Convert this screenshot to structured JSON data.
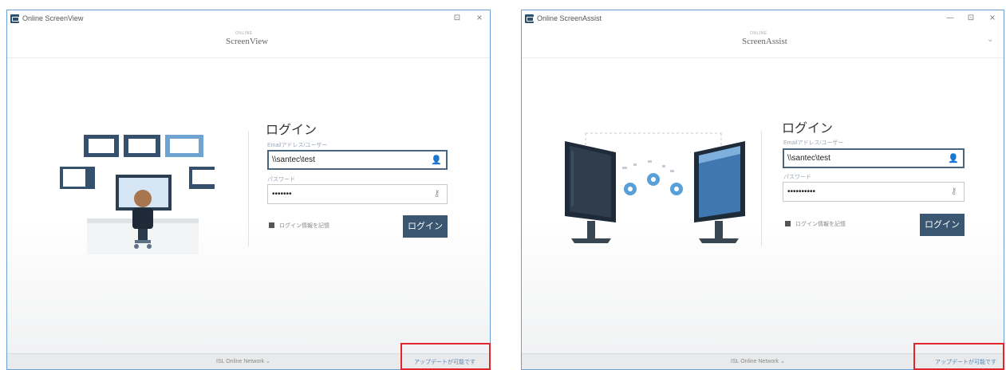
{
  "left_window": {
    "title": "Online ScreenView",
    "window_controls": [
      "⊡",
      "×"
    ],
    "header": {
      "logo_small": "ONLINE",
      "logo": "ScreenView"
    },
    "login": {
      "heading": "ログイン",
      "email_label": "Emailアドレス/ユーザー",
      "email_value": "\\\\santec\\test",
      "password_label": "パスワード",
      "password_value": "•••••••",
      "remember_label": "ログイン情報を記憶",
      "button_label": "ログイン"
    },
    "footer": {
      "center_text": "ISL Online Network ⌄",
      "link_text": "アップデートが可能です"
    }
  },
  "right_window": {
    "title": "Online ScreenAssist",
    "window_controls": [
      "—",
      "⊡",
      "×"
    ],
    "header": {
      "logo_small": "ONLINE",
      "logo": "ScreenAssist",
      "menu": "⌄"
    },
    "login": {
      "heading": "ログイン",
      "email_label": "Emailアドレス/ユーザー",
      "email_value": "\\\\santec\\test",
      "password_label": "パスワード",
      "password_value": "••••••••••",
      "remember_label": "ログイン情報を記憶",
      "button_label": "ログイン"
    },
    "footer": {
      "center_text": "ISL Online Network ⌄",
      "link_text": "アップデートが可能です"
    }
  },
  "colors": {
    "window_border": "#6a9fd4",
    "login_button": "#3a5670",
    "highlight": "#e0262b",
    "link": "#5b86b5"
  },
  "icons": [
    "app-icon",
    "user-icon",
    "key-icon",
    "maximize-icon",
    "close-icon",
    "minimize-icon",
    "chevron-down-icon"
  ]
}
